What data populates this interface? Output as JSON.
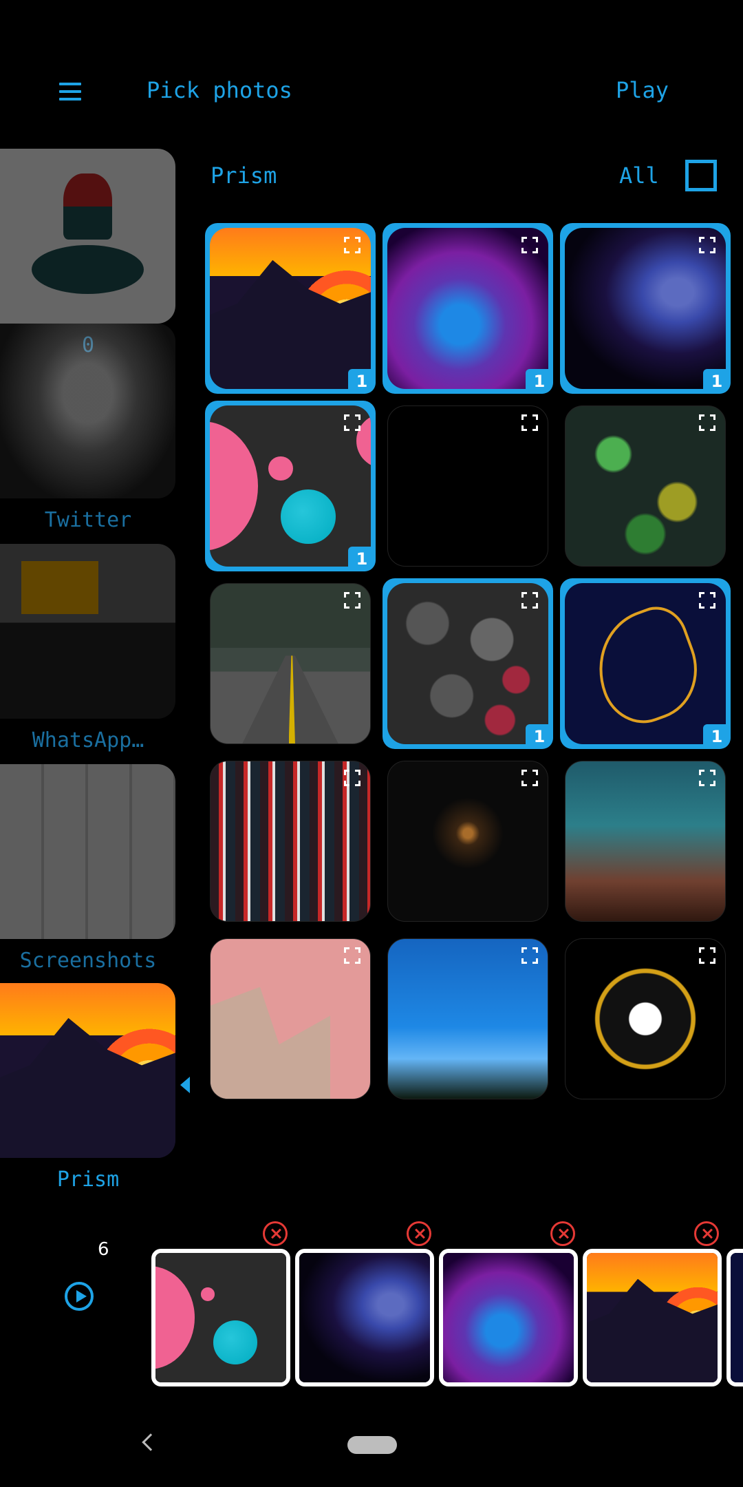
{
  "header": {
    "title": "Pick photos",
    "play_label": "Play"
  },
  "albums": [
    {
      "label": "0",
      "icon": "illustration-thumb"
    },
    {
      "label": "Twitter",
      "icon": "portrait-thumb"
    },
    {
      "label": "WhatsApp…",
      "icon": "laptop-thumb"
    },
    {
      "label": "Screenshots",
      "icon": "collage-thumb"
    },
    {
      "label": "Prism",
      "icon": "prism-thumb",
      "active": true
    }
  ],
  "grid": {
    "album_title": "Prism",
    "select_all_label": "All",
    "photos": [
      {
        "art": "prism",
        "selected": true,
        "count": "1"
      },
      {
        "art": "nebula",
        "selected": true,
        "count": "1"
      },
      {
        "art": "smoke",
        "selected": true,
        "count": "1"
      },
      {
        "art": "dots",
        "selected": true,
        "count": "1"
      },
      {
        "art": "black",
        "selected": false,
        "count": ""
      },
      {
        "art": "floral",
        "selected": false,
        "count": ""
      },
      {
        "art": "road",
        "selected": false,
        "count": ""
      },
      {
        "art": "stones",
        "selected": true,
        "count": "1"
      },
      {
        "art": "horse",
        "selected": true,
        "count": "1"
      },
      {
        "art": "tokyo",
        "selected": false,
        "count": ""
      },
      {
        "art": "soldiers",
        "selected": false,
        "count": ""
      },
      {
        "art": "city",
        "selected": false,
        "count": ""
      },
      {
        "art": "pink",
        "selected": false,
        "count": ""
      },
      {
        "art": "sky",
        "selected": false,
        "count": ""
      },
      {
        "art": "skull",
        "selected": false,
        "count": ""
      }
    ]
  },
  "strip": {
    "count": "6",
    "items": [
      {
        "art": "dots"
      },
      {
        "art": "smoke"
      },
      {
        "art": "nebula"
      },
      {
        "art": "prism"
      },
      {
        "art": "horse"
      }
    ]
  },
  "colors": {
    "accent": "#1ea3e6",
    "remove": "#e53935",
    "background": "#000000"
  }
}
